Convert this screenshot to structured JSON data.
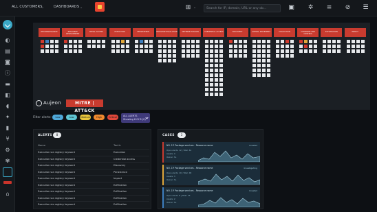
{
  "topbar": {
    "customer_select": "ALL CUSTOMERS",
    "dashboard_select": "DASHBOARDS",
    "search_placeholder": "Search for IP, domain, URL or any ob..."
  },
  "sidebar": {
    "icons": [
      "check-icon",
      "palette-icon",
      "clipboard-icon",
      "inbox-icon",
      "info-icon",
      "folder-icon",
      "window-icon",
      "shield-icon",
      "settings-icon",
      "file-icon",
      "funnel-icon",
      "gear-icon",
      "globe-icon",
      "dashboard-icon",
      "alert-icon",
      "building-icon"
    ]
  },
  "matrix": {
    "tactics": [
      "RECONNAISSANCE",
      "RESOURCE DEVELOPMENT",
      "INITIAL ACCESS",
      "EXECUTION",
      "PERSISTENCE",
      "PRIVILEGE ESCALATION",
      "DEFENSE EVASION",
      "CREDENTIAL ACCESS",
      "DISCOVERY",
      "LATERAL MOVEMENT",
      "COLLECTION",
      "COMMAND AND CONTROL",
      "EXFILTRATION",
      "IMPACT"
    ],
    "brand_name": "Aujeon",
    "mitre_badge": "MITRE | ATT&CK"
  },
  "filters": {
    "label": "Filter alerts:",
    "pills": [
      {
        "label": "Low",
        "color": "#4fa8d8"
      },
      {
        "label": "Low",
        "color": "#60c6d3"
      },
      {
        "label": "Medium",
        "color": "#e8c53b"
      },
      {
        "label": "High",
        "color": "#f08a2e"
      },
      {
        "label": "Critical",
        "color": "#e2483a"
      }
    ],
    "actions_title": "ALL ALERTS",
    "actions_sub": "Showing 8 Of 8 (0)"
  },
  "alerts": {
    "title": "ALERTS",
    "count": "8",
    "col_name": "Name",
    "col_tactic": "Tactic",
    "rows": [
      {
        "name": "Execution via registry keyword",
        "tactic": "Execution"
      },
      {
        "name": "Execution via registry keyword",
        "tactic": "Credential access"
      },
      {
        "name": "Execution via registry keyword",
        "tactic": "Discovery"
      },
      {
        "name": "Execution via registry keyword",
        "tactic": "Persistence"
      },
      {
        "name": "Execution via registry keyword",
        "tactic": "Impact"
      },
      {
        "name": "Execution via registry keyword",
        "tactic": "Exfiltration"
      },
      {
        "name": "Execution via registry keyword",
        "tactic": "Exfiltration"
      },
      {
        "name": "Execution via registry keyword",
        "tactic": "Exfiltration"
      },
      {
        "name": "Execution via registry keyword",
        "tactic": "Exfiltration"
      }
    ]
  },
  "cases": {
    "title": "CASES",
    "count": "3",
    "items": [
      {
        "title": "NO. 1P. Package services - Resource name",
        "tag": "Created",
        "accent": "#c93b2f",
        "meta1": "Open alerts: 12 | Total: 61",
        "meta2": "Assets: 4",
        "meta3": "Owner: SL"
      },
      {
        "title": "NO. 1P. Package services - Resource name",
        "tag": "Investigating",
        "accent": "#e2a83a",
        "meta1": "Open alerts: 10 | Total: 48",
        "meta2": "Assets: 3",
        "meta3": "Owner: SL"
      },
      {
        "title": "NO. 1P. Package services - Resource name",
        "tag": "Created",
        "accent": "#3e7fbf",
        "meta1": "Open alerts: 8 | Total: 35",
        "meta2": "Assets: 2",
        "meta3": "Owner: SL"
      }
    ]
  }
}
